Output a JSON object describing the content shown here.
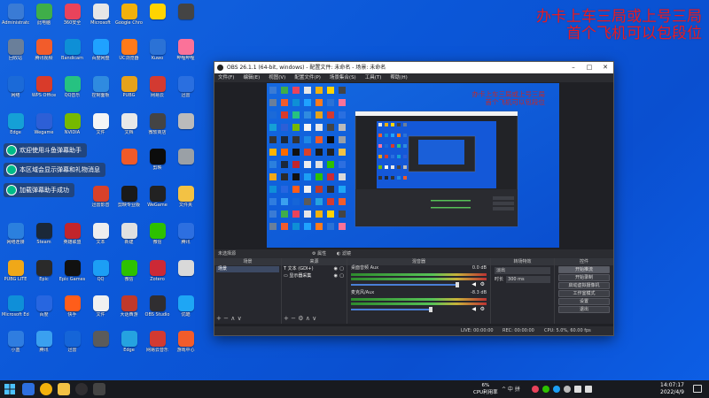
{
  "banner": {
    "line1": "办卡上车三局或上号三局",
    "line2": "首个飞机可以包段位"
  },
  "notifications": [
    "欢迎使用斗鱼弹幕助手",
    "本区域会显示弹幕和礼物消息",
    "加载弹幕助手成功"
  ],
  "desktop_icons": [
    {
      "label": "Administrator",
      "color": "#3a7bd5"
    },
    {
      "label": "此电脑",
      "color": "#3fae49"
    },
    {
      "label": "360安全",
      "color": "#e9435b"
    },
    {
      "label": "Microsoft",
      "color": "#e6e6e6"
    },
    {
      "label": "Google Chrome",
      "color": "#f2b10c"
    },
    {
      "label": "",
      "color": "#ffd400"
    },
    {
      "label": "",
      "color": "#444"
    },
    {
      "label": "回收站",
      "color": "#6a7f9a"
    },
    {
      "label": "腾讯视频",
      "color": "#f25c2b"
    },
    {
      "label": "Bandicam",
      "color": "#0e8fd6"
    },
    {
      "label": "百度网盘",
      "color": "#1fa2ff"
    },
    {
      "label": "UC浏览器",
      "color": "#ff7a1a"
    },
    {
      "label": "Kuwo",
      "color": "#2b72d6"
    },
    {
      "label": "哔哩哔哩",
      "color": "#fb7299"
    },
    {
      "label": "网络",
      "color": "#1b6ad8"
    },
    {
      "label": "WPS Office",
      "color": "#d93b2a"
    },
    {
      "label": "QQ音乐",
      "color": "#26c281"
    },
    {
      "label": "控制面板",
      "color": "#2f8be0"
    },
    {
      "label": "PUBG",
      "color": "#e6a21b"
    },
    {
      "label": "网易云",
      "color": "#d33a31"
    },
    {
      "label": "迅雷",
      "color": "#2a6fe0"
    },
    {
      "label": "Edge",
      "color": "#15a0d6"
    },
    {
      "label": "Wegame",
      "color": "#2d5fd6"
    },
    {
      "label": "NVIDIA",
      "color": "#76b900"
    },
    {
      "label": "文件",
      "color": "#f5f5f5"
    },
    {
      "label": "文档",
      "color": "#e8e8e8"
    },
    {
      "label": "微软商店",
      "color": "#444"
    },
    {
      "label": "",
      "color": "#bbbbbb"
    },
    {
      "label": "游戏",
      "color": "#333"
    },
    {
      "label": "Steam",
      "color": "#1b2838"
    },
    {
      "label": "OBS",
      "color": "#333"
    },
    {
      "label": "腾讯会议",
      "color": "#1e88e5"
    },
    {
      "label": "",
      "color": "#f05a28"
    },
    {
      "label": "剪映",
      "color": "#0c0c0c"
    },
    {
      "label": "",
      "color": "#9aa0a6"
    },
    {
      "label": "鲁大师",
      "color": "#ffb400"
    },
    {
      "label": "火绒",
      "color": "#ff6a00"
    },
    {
      "label": "CapCut",
      "color": "#111"
    },
    {
      "label": "迅雷影音",
      "color": "#d8412a"
    },
    {
      "label": "剪映专业版",
      "color": "#1a1a1a"
    },
    {
      "label": "WeGame",
      "color": "#222"
    },
    {
      "label": "文件夹",
      "color": "#f3c244"
    },
    {
      "label": "网络连接",
      "color": "#2b80de"
    },
    {
      "label": "Steam",
      "color": "#1b2838"
    },
    {
      "label": "英雄联盟",
      "color": "#c2252b"
    },
    {
      "label": "文本",
      "color": "#eeeeee"
    },
    {
      "label": "新建",
      "color": "#e0e0e0"
    },
    {
      "label": "微信",
      "color": "#2dc100"
    },
    {
      "label": "腾讯",
      "color": "#2d6fe0"
    },
    {
      "label": "PUBG LITE",
      "color": "#f0a818"
    },
    {
      "label": "Epic",
      "color": "#2a2a2a"
    },
    {
      "label": "Epic Games",
      "color": "#111"
    },
    {
      "label": "QQ",
      "color": "#1c9ff5"
    },
    {
      "label": "微信",
      "color": "#2dc100"
    },
    {
      "label": "Zotero",
      "color": "#cc2936"
    },
    {
      "label": "",
      "color": "#d9d9d9"
    },
    {
      "label": "Microsoft Edge",
      "color": "#0f8fd8"
    },
    {
      "label": "百度",
      "color": "#2766e0"
    },
    {
      "label": "快手",
      "color": "#ff5d1a"
    },
    {
      "label": "文件",
      "color": "#f0f0f0"
    },
    {
      "label": "大话西游",
      "color": "#c0392b"
    },
    {
      "label": "OBS Studio",
      "color": "#302e31"
    },
    {
      "label": "优酷",
      "color": "#1ea6f5"
    },
    {
      "label": "小蓝",
      "color": "#2f7de0"
    },
    {
      "label": "腾讯",
      "color": "#3aa0f0"
    },
    {
      "label": "迅雷",
      "color": "#1565d8"
    },
    {
      "label": "",
      "color": "#5b5b5b"
    },
    {
      "label": "Edge",
      "color": "#25a3e0"
    },
    {
      "label": "网易云音乐",
      "color": "#d33a31"
    },
    {
      "label": "游戏中心",
      "color": "#f25c2b"
    }
  ],
  "obs": {
    "title": "OBS 26.1.1 (64-bit, windows) - 配置文件: 未命名 - 场景: 未命名",
    "menu": [
      "文件(F)",
      "编辑(E)",
      "视图(V)",
      "配置文件(P)",
      "场景集合(S)",
      "工具(T)",
      "帮助(H)"
    ],
    "nested_banner_1": "办卡上车三局或上号三局",
    "nested_banner_2": "首个飞机可以包段位",
    "selected_source": "未选择源",
    "props_btn": "属性",
    "filters_btn": "滤镜",
    "docks": {
      "scenes_header": "场景",
      "scenes": [
        "场景"
      ],
      "sources_header": "来源",
      "sources": [
        "文本 (GDI+)",
        "显示器采集"
      ],
      "mixer_header": "混音器",
      "mixer_track1": "桌面音频 Aux",
      "mixer_track1_db": "0.0 dB",
      "mixer_track2": "麦克风/Aux",
      "mixer_track2_db": "-8.3 dB",
      "transitions_header": "转场特效",
      "transition_type": "淡出",
      "duration_label": "时长",
      "duration_value": "300 ms",
      "controls_header": "控件",
      "controls": [
        "开始推流",
        "开始录制",
        "启动虚拟摄像机",
        "工作室模式",
        "设置",
        "退出"
      ]
    },
    "status": {
      "live": "LIVE: 00:00:00",
      "rec": "REC: 00:00:00",
      "cpu": "CPU: 5.0%, 60.00 fps"
    }
  },
  "taskbar": {
    "cpu_percent": "6%",
    "cpu_label": "CPU利用率",
    "tray": "^ 中 拼",
    "time": "14:07:17",
    "date": "2022/4/9"
  }
}
